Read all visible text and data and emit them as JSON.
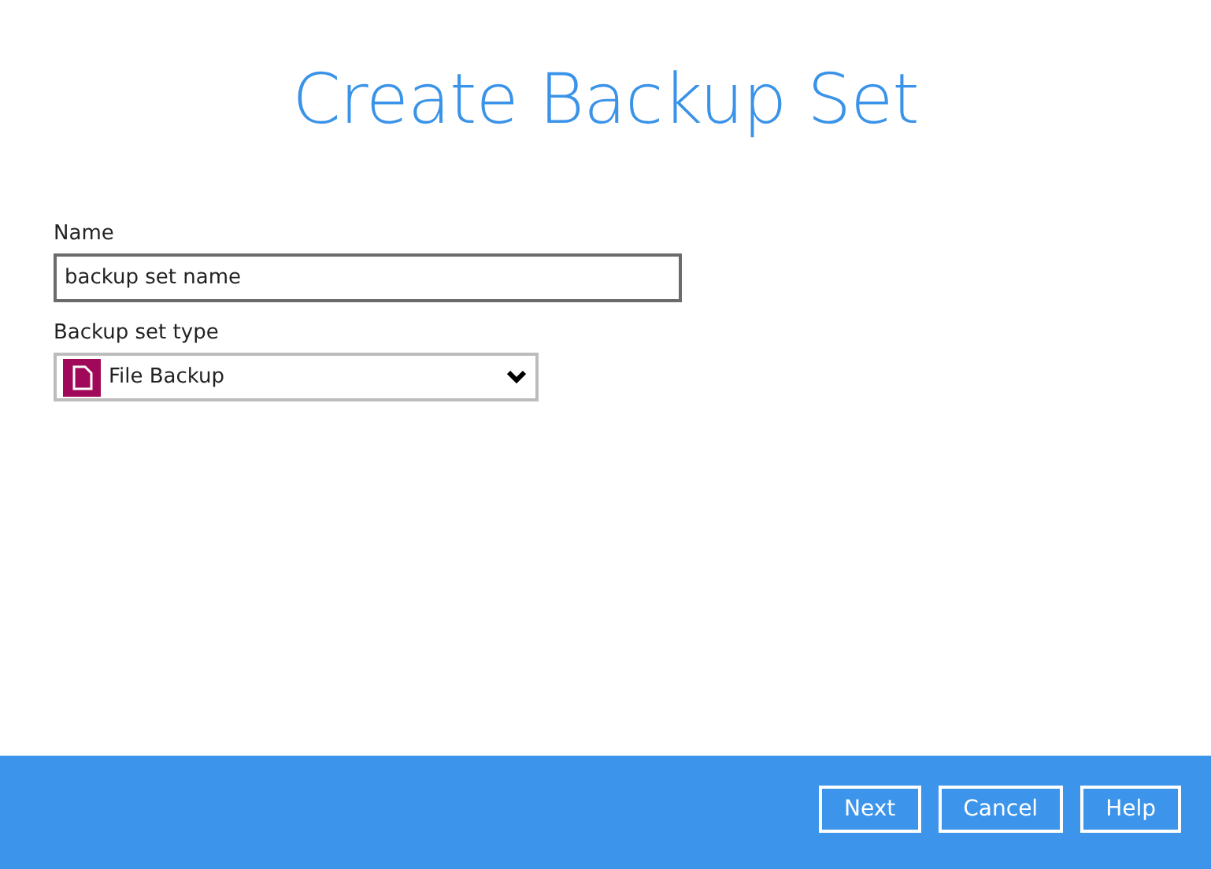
{
  "title": "Create Backup Set",
  "fields": [
    {
      "kind": "text",
      "label": "Name",
      "value": "backup set name"
    },
    {
      "kind": "select",
      "label": "Backup set type",
      "value": "File Backup"
    }
  ],
  "buttons": [
    "Next",
    "Cancel",
    "Help"
  ]
}
